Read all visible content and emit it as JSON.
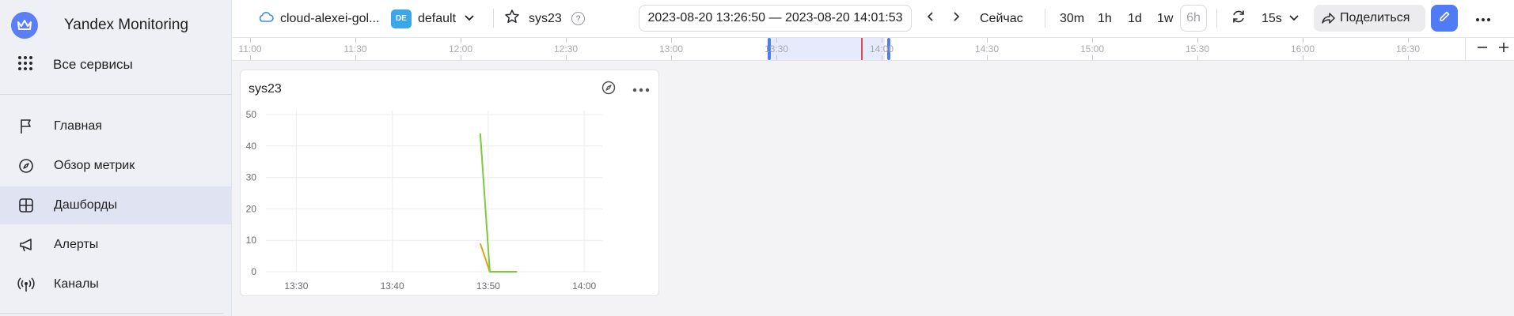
{
  "sidebar": {
    "brand_title": "Yandex Monitoring",
    "services_label": "Все сервисы",
    "nav": [
      {
        "label": "Главная",
        "icon": "flag-icon"
      },
      {
        "label": "Обзор метрик",
        "icon": "compass-icon"
      },
      {
        "label": "Дашборды",
        "icon": "dashboard-icon",
        "active": true
      },
      {
        "label": "Алерты",
        "icon": "megaphone-icon"
      },
      {
        "label": "Каналы",
        "icon": "broadcast-icon"
      }
    ]
  },
  "header": {
    "cloud_name": "cloud-alexei-gol...",
    "folder_badge": "DE",
    "folder_name": "default",
    "dashboard_name": "sys23",
    "help_label": "?",
    "date_range": "2023-08-20 13:26:50 — 2023-08-20 14:01:53",
    "now_label": "Сейчас",
    "presets": [
      "30m",
      "1h",
      "1d",
      "1w",
      "6h"
    ],
    "refresh_interval": "15s",
    "share_label": "Поделиться"
  },
  "timeline": {
    "ticks": [
      "11:00",
      "11:30",
      "12:00",
      "12:30",
      "13:00",
      "13:30",
      "14:00",
      "14:30",
      "15:00",
      "15:30",
      "16:00",
      "16:30"
    ],
    "selection": {
      "from": "13:26:50",
      "to": "14:01:53"
    },
    "now": "13:53"
  },
  "panel": {
    "title": "sys23"
  },
  "chart_data": {
    "type": "line",
    "title": "sys23",
    "xlabel": "",
    "ylabel": "",
    "x_ticks": [
      "13:30",
      "13:40",
      "13:50",
      "14:00"
    ],
    "y_ticks": [
      0,
      10,
      20,
      30,
      40,
      50
    ],
    "ylim": [
      0,
      50
    ],
    "xlim": [
      "13:26:50",
      "14:01:53"
    ],
    "grid": true,
    "series": [
      {
        "color": "#7ec93f",
        "x": [
          "13:49:10",
          "13:50:10",
          "13:53:00"
        ],
        "y": [
          44,
          0,
          0
        ]
      },
      {
        "color": "#e0a020",
        "x": [
          "13:49:10",
          "13:50:10"
        ],
        "y": [
          9,
          0
        ]
      }
    ]
  },
  "colors": {
    "accent": "#4f7cf5",
    "sidebar_bg": "#eef0f6",
    "active_nav_bg": "#dfe3f2",
    "now_marker": "#e5494d"
  }
}
